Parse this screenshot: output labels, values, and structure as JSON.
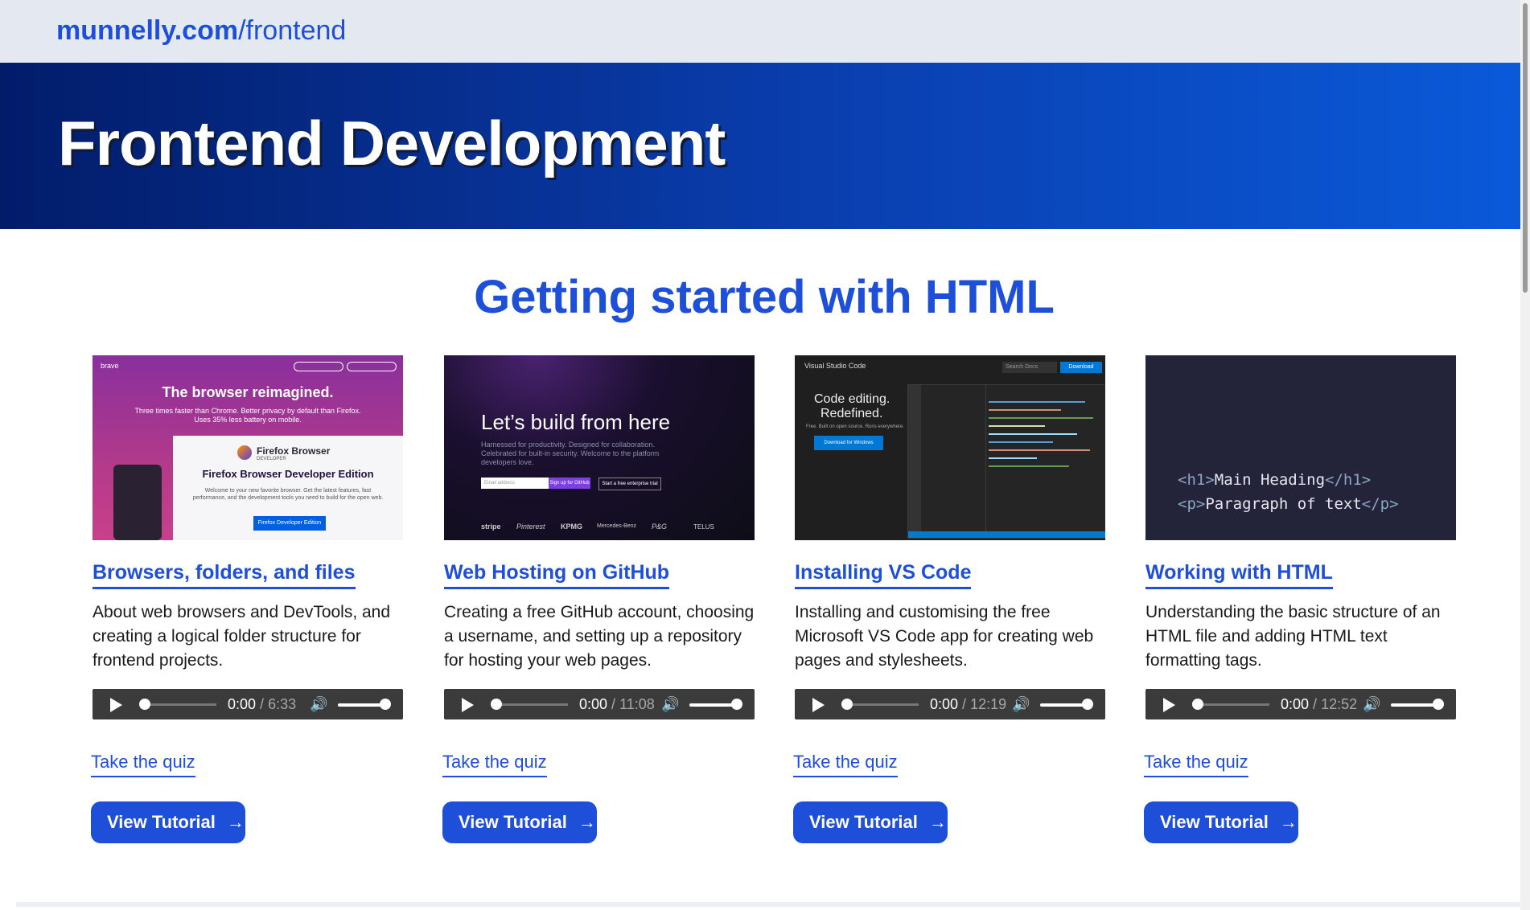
{
  "header": {
    "domain": "munnelly.com",
    "path": "/frontend"
  },
  "hero": {
    "title": "Frontend Development"
  },
  "section": {
    "title": "Getting started with HTML"
  },
  "cards": [
    {
      "title": "Browsers, folders, and files",
      "description": "About web browsers and DevTools, and creating a logical folder structure for frontend projects.",
      "audio": {
        "current": "0:00",
        "duration": "6:33"
      },
      "quiz_label": "Take the quiz",
      "button_label": "View Tutorial",
      "thumb": {
        "headline": "The browser reimagined.",
        "sub": "Three times faster than Chrome. Better privacy by default than Firefox. Uses 35% less battery on mobile.",
        "brand": "brave",
        "panel_title": "Firefox Browser Developer Edition",
        "panel_logo": "Firefox Browser",
        "panel_logo_sub": "DEVELOPER",
        "panel_text": "Welcome to your new favorite browser. Get the latest features, fast performance, and the development tools you need to build for the open web.",
        "panel_button": "Firefox Developer Edition"
      }
    },
    {
      "title": "Web Hosting on GitHub",
      "description": "Creating a free GitHub account, choosing a username, and setting up a repository for hosting your web pages.",
      "audio": {
        "current": "0:00",
        "duration": "11:08"
      },
      "quiz_label": "Take the quiz",
      "button_label": "View Tutorial",
      "thumb": {
        "headline": "Let’s build from here",
        "sub": "Harnessed for productivity. Designed for collaboration. Celebrated for built-in security. Welcome to the platform developers love.",
        "email_placeholder": "Email address",
        "signup": "Sign up for GitHub",
        "trial": "Start a free enterprise trial",
        "logos": [
          "stripe",
          "Pinterest",
          "KPMG",
          "Mercedes-Benz",
          "P&G",
          "TELUS"
        ]
      }
    },
    {
      "title": "Installing VS Code",
      "description": "Installing and customising the free Microsoft VS Code app for creating web pages and stylesheets.",
      "audio": {
        "current": "0:00",
        "duration": "12:19"
      },
      "quiz_label": "Take the quiz",
      "button_label": "View Tutorial",
      "thumb": {
        "brand": "Visual Studio Code",
        "headline1": "Code editing.",
        "headline2": "Redefined.",
        "sub": "Free. Built on open source. Runs everywhere.",
        "download": "Download for Windows",
        "search": "Search Docs",
        "download_btn": "Download"
      }
    },
    {
      "title": "Working with HTML",
      "description": "Understanding the basic structure of an HTML file and adding HTML text formatting tags.",
      "audio": {
        "current": "0:00",
        "duration": "12:52"
      },
      "quiz_label": "Take the quiz",
      "button_label": "View Tutorial",
      "thumb": {
        "line1_open": "<h1>",
        "line1_text": "Main Heading",
        "line1_close": "</h1>",
        "line2_open": "<p>",
        "line2_text": "Paragraph of text",
        "line2_close": "</p>"
      }
    }
  ]
}
